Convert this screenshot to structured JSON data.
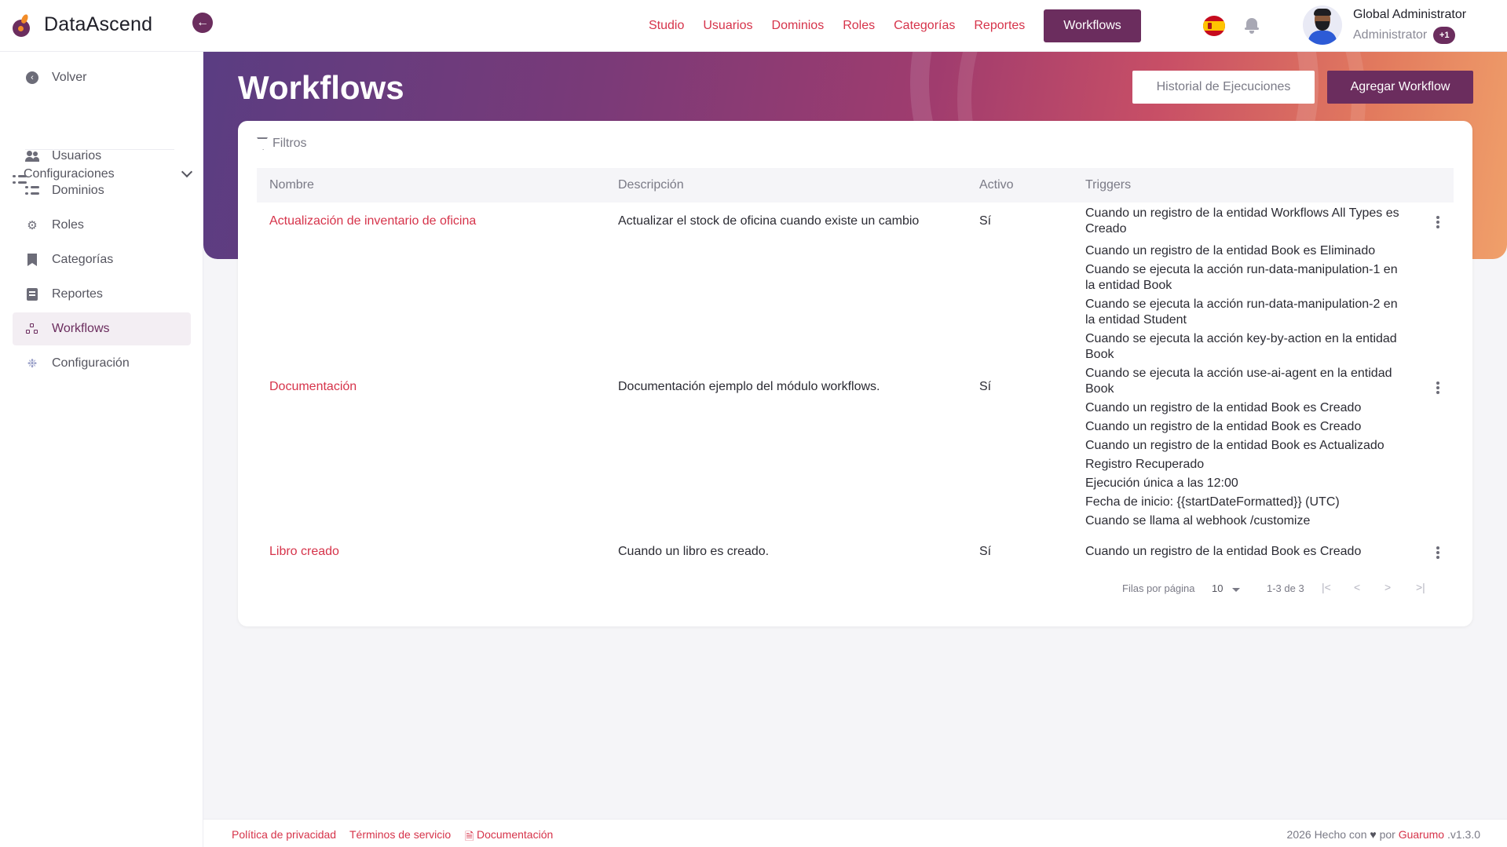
{
  "brand": {
    "name": "DataAscend"
  },
  "topnav": {
    "items": [
      "Studio",
      "Usuarios",
      "Dominios",
      "Roles",
      "Categorías",
      "Reportes"
    ],
    "active": "Workflows"
  },
  "user": {
    "name": "Global Administrator",
    "role": "Administrator",
    "extra_roles": "+1"
  },
  "sidebar": {
    "back": "Volver",
    "group": "Configuraciones",
    "items": [
      "Usuarios",
      "Dominios",
      "Roles",
      "Categorías",
      "Reportes",
      "Workflows",
      "Configuración"
    ],
    "active_index": 5
  },
  "page": {
    "title": "Workflows",
    "history_button": "Historial de Ejecuciones",
    "add_button": "Agregar Workflow",
    "filters_label": "Filtros"
  },
  "table": {
    "columns": [
      "Nombre",
      "Descripción",
      "Activo",
      "Triggers"
    ],
    "rows": [
      {
        "name": "Actualización de inventario de oficina",
        "description": "Actualizar el stock de oficina cuando existe un cambio",
        "active": "Sí",
        "triggers": [
          "Cuando un registro de la entidad Workflows All Types es Creado"
        ]
      },
      {
        "name": "Documentación",
        "description": "Documentación ejemplo del módulo workflows.",
        "active": "Sí",
        "triggers": [
          "Cuando un registro de la entidad Book es Eliminado",
          "Cuando se ejecuta la acción run-data-manipulation-1 en la entidad Book",
          "Cuando se ejecuta la acción run-data-manipulation-2 en la entidad Student",
          "Cuando se ejecuta la acción key-by-action en la entidad Book",
          "Cuando se ejecuta la acción use-ai-agent en la entidad Book",
          "Cuando un registro de la entidad Book es Creado",
          "Cuando un registro de la entidad Book es Creado",
          "Cuando un registro de la entidad Book es Actualizado",
          "Registro Recuperado",
          "Ejecución única a las 12:00",
          "Fecha de inicio: {{startDateFormatted}} (UTC)",
          "Cuando se llama al webhook /customize"
        ]
      },
      {
        "name": "Libro creado",
        "description": "Cuando un libro es creado.",
        "active": "Sí",
        "triggers": [
          "Cuando un registro de la entidad Book es Creado"
        ]
      }
    ]
  },
  "pagination": {
    "rows_per_page_label": "Filas por página",
    "rows_per_page": "10",
    "range": "1-3 de 3",
    "first": "|<",
    "prev": "<",
    "next": ">",
    "last": ">|"
  },
  "footer": {
    "privacy": "Política de privacidad",
    "terms": "Términos de servicio",
    "docs": "Documentación",
    "made_prefix": "2026 Hecho con",
    "made_by": "por",
    "company": "Guarumo",
    "version": ".v1.3.0"
  },
  "colors": {
    "accent": "#6b2d5e",
    "link": "#d6334a"
  }
}
